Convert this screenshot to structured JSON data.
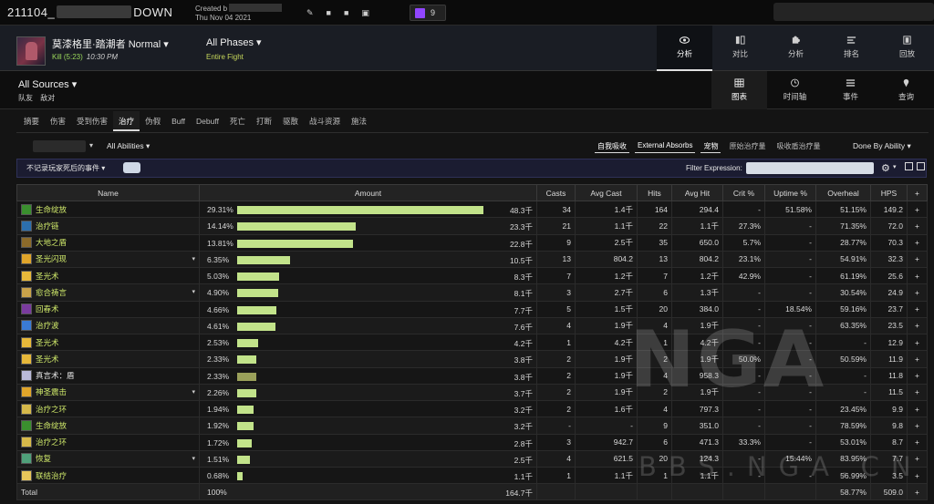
{
  "header": {
    "title_prefix": "211104_",
    "title_suffix": "DOWN",
    "created_label": "Created b",
    "created_date": "Thu Nov 04 2021",
    "twitch_count": "9"
  },
  "fight": {
    "boss": "莫漆格里·踏潮者 Normal",
    "kill": "Kill (5:23)",
    "time": "10:30 PM",
    "phase_title": "All Phases",
    "phase_sub": "Entire Fight"
  },
  "view_tabs": [
    "分析",
    "对比",
    "分析",
    "排名",
    "回放"
  ],
  "sources": {
    "title": "All Sources",
    "sub1": "队友",
    "sub2": "敌对"
  },
  "mode_tabs": [
    "图表",
    "时间轴",
    "事件",
    "查询"
  ],
  "category_tabs": [
    "摘要",
    "伤害",
    "受到伤害",
    "治疗",
    "伪假",
    "Buff",
    "Debuff",
    "死亡",
    "打断",
    "驱散",
    "战斗资源",
    "施法"
  ],
  "filters": {
    "abilities": "All Abilities",
    "toggles": [
      "自我吸收",
      "External Absorbs",
      "宠物",
      "原始治疗量",
      "吸收盾治疗量"
    ],
    "done_by": "Done By Ability",
    "option_select": "不记录玩家死后的事件",
    "filter_label": "Filter Expression:"
  },
  "table": {
    "headers": [
      "Name",
      "Amount",
      "Casts",
      "Avg Cast",
      "Hits",
      "Avg Hit",
      "Crit %",
      "Uptime %",
      "Overheal",
      "HPS",
      "+"
    ],
    "rows": [
      {
        "name": "生命绽放",
        "pct": "29.31%",
        "bar": 0.2931,
        "amount": "48.3千",
        "casts": "34",
        "avg_cast": "1.4千",
        "hits": "164",
        "avg_hit": "294.4",
        "crit": "-",
        "uptime": "51.58%",
        "overheal": "51.15%",
        "hps": "149.2",
        "plus": "+",
        "icon_color": "#3a8f2e",
        "expand": ""
      },
      {
        "name": "治疗链",
        "pct": "14.14%",
        "bar": 0.1414,
        "amount": "23.3千",
        "casts": "21",
        "avg_cast": "1.1千",
        "hits": "22",
        "avg_hit": "1.1千",
        "crit": "27.3%",
        "uptime": "-",
        "overheal": "71.35%",
        "hps": "72.0",
        "plus": "+",
        "icon_color": "#2c6fae",
        "expand": ""
      },
      {
        "name": "大地之盾",
        "pct": "13.81%",
        "bar": 0.1381,
        "amount": "22.8千",
        "casts": "9",
        "avg_cast": "2.5千",
        "hits": "35",
        "avg_hit": "650.0",
        "crit": "5.7%",
        "uptime": "-",
        "overheal": "28.77%",
        "hps": "70.3",
        "plus": "+",
        "icon_color": "#8b6a2a",
        "expand": ""
      },
      {
        "name": "圣光闪现",
        "pct": "6.35%",
        "bar": 0.0635,
        "amount": "10.5千",
        "casts": "13",
        "avg_cast": "804.2",
        "hits": "13",
        "avg_hit": "804.2",
        "crit": "23.1%",
        "uptime": "-",
        "overheal": "54.91%",
        "hps": "32.3",
        "plus": "+",
        "icon_color": "#e0a52a",
        "expand": "▾"
      },
      {
        "name": "圣光术",
        "pct": "5.03%",
        "bar": 0.0503,
        "amount": "8.3千",
        "casts": "7",
        "avg_cast": "1.2千",
        "hits": "7",
        "avg_hit": "1.2千",
        "crit": "42.9%",
        "uptime": "-",
        "overheal": "61.19%",
        "hps": "25.6",
        "plus": "+",
        "icon_color": "#e8b93a",
        "expand": ""
      },
      {
        "name": "愈合祷言",
        "pct": "4.90%",
        "bar": 0.049,
        "amount": "8.1千",
        "casts": "3",
        "avg_cast": "2.7千",
        "hits": "6",
        "avg_hit": "1.3千",
        "crit": "-",
        "uptime": "-",
        "overheal": "30.54%",
        "hps": "24.9",
        "plus": "+",
        "icon_color": "#c9a24a",
        "expand": "▾"
      },
      {
        "name": "回春术",
        "pct": "4.66%",
        "bar": 0.0466,
        "amount": "7.7千",
        "casts": "5",
        "avg_cast": "1.5千",
        "hits": "20",
        "avg_hit": "384.0",
        "crit": "-",
        "uptime": "18.54%",
        "overheal": "59.16%",
        "hps": "23.7",
        "plus": "+",
        "icon_color": "#7a3b9e",
        "expand": ""
      },
      {
        "name": "治疗波",
        "pct": "4.61%",
        "bar": 0.0461,
        "amount": "7.6千",
        "casts": "4",
        "avg_cast": "1.9千",
        "hits": "4",
        "avg_hit": "1.9千",
        "crit": "-",
        "uptime": "-",
        "overheal": "63.35%",
        "hps": "23.5",
        "plus": "+",
        "icon_color": "#3a7bd5",
        "expand": ""
      },
      {
        "name": "圣光术",
        "pct": "2.53%",
        "bar": 0.0253,
        "amount": "4.2千",
        "casts": "1",
        "avg_cast": "4.2千",
        "hits": "1",
        "avg_hit": "4.2千",
        "crit": "-",
        "uptime": "-",
        "overheal": "-",
        "hps": "12.9",
        "plus": "+",
        "icon_color": "#e8b93a",
        "expand": ""
      },
      {
        "name": "圣光术",
        "pct": "2.33%",
        "bar": 0.0233,
        "amount": "3.8千",
        "casts": "2",
        "avg_cast": "1.9千",
        "hits": "2",
        "avg_hit": "1.9千",
        "crit": "50.0%",
        "uptime": "-",
        "overheal": "50.59%",
        "hps": "11.9",
        "plus": "+",
        "icon_color": "#e8b93a",
        "expand": ""
      },
      {
        "name": "真言术：盾",
        "pct": "2.33%",
        "bar": 0.0233,
        "amount": "3.8千",
        "casts": "2",
        "avg_cast": "1.9千",
        "hits": "4",
        "avg_hit": "958.3",
        "crit": "-",
        "uptime": "-",
        "overheal": "-",
        "hps": "11.8",
        "plus": "+",
        "icon_color": "#b9b9d9",
        "expand": "",
        "white": true,
        "dim": true
      },
      {
        "name": "神圣震击",
        "pct": "2.26%",
        "bar": 0.0226,
        "amount": "3.7千",
        "casts": "2",
        "avg_cast": "1.9千",
        "hits": "2",
        "avg_hit": "1.9千",
        "crit": "-",
        "uptime": "-",
        "overheal": "-",
        "hps": "11.5",
        "plus": "+",
        "icon_color": "#e0a52a",
        "expand": "▾"
      },
      {
        "name": "治疗之环",
        "pct": "1.94%",
        "bar": 0.0194,
        "amount": "3.2千",
        "casts": "2",
        "avg_cast": "1.6千",
        "hits": "4",
        "avg_hit": "797.3",
        "crit": "-",
        "uptime": "-",
        "overheal": "23.45%",
        "hps": "9.9",
        "plus": "+",
        "icon_color": "#d6b94a",
        "expand": ""
      },
      {
        "name": "生命绽放",
        "pct": "1.92%",
        "bar": 0.0192,
        "amount": "3.2千",
        "casts": "-",
        "avg_cast": "-",
        "hits": "9",
        "avg_hit": "351.0",
        "crit": "-",
        "uptime": "-",
        "overheal": "78.59%",
        "hps": "9.8",
        "plus": "+",
        "icon_color": "#3a8f2e",
        "expand": ""
      },
      {
        "name": "治疗之环",
        "pct": "1.72%",
        "bar": 0.0172,
        "amount": "2.8千",
        "casts": "3",
        "avg_cast": "942.7",
        "hits": "6",
        "avg_hit": "471.3",
        "crit": "33.3%",
        "uptime": "-",
        "overheal": "53.01%",
        "hps": "8.7",
        "plus": "+",
        "icon_color": "#d6b94a",
        "expand": ""
      },
      {
        "name": "恢复",
        "pct": "1.51%",
        "bar": 0.0151,
        "amount": "2.5千",
        "casts": "4",
        "avg_cast": "621.5",
        "hits": "20",
        "avg_hit": "124.3",
        "crit": "-",
        "uptime": "15.44%",
        "overheal": "83.95%",
        "hps": "7.7",
        "plus": "+",
        "icon_color": "#4fa07a",
        "expand": "▾"
      },
      {
        "name": "联结治疗",
        "pct": "0.68%",
        "bar": 0.0068,
        "amount": "1.1千",
        "casts": "1",
        "avg_cast": "1.1千",
        "hits": "1",
        "avg_hit": "1.1千",
        "crit": "-",
        "uptime": "-",
        "overheal": "56.99%",
        "hps": "3.5",
        "plus": "+",
        "icon_color": "#e8c65a",
        "expand": ""
      }
    ],
    "total": {
      "label": "Total",
      "pct": "100%",
      "amount": "164.7千",
      "overheal": "58.77%",
      "hps": "509.0",
      "plus": "+"
    }
  },
  "watermark": {
    "big": "NGA",
    "small": "BBS.NGA.CN"
  }
}
